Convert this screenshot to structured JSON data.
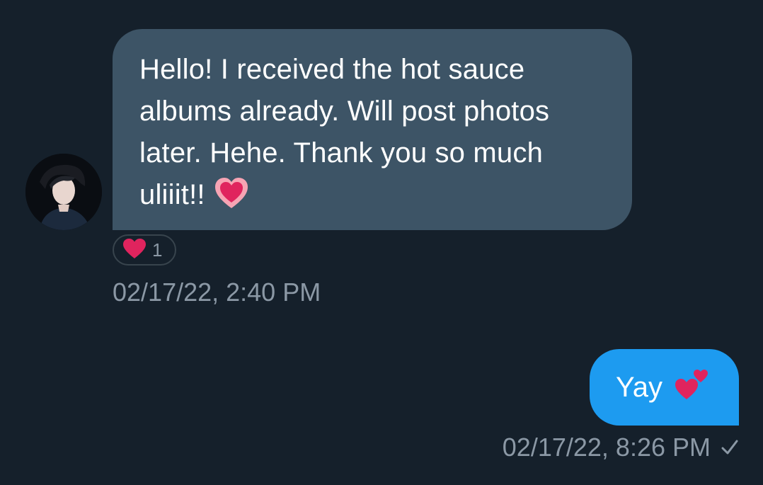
{
  "conversation": {
    "received_message": {
      "lines": [
        "Hello! I received the hot sauce",
        "albums already. Will post photos",
        "later. Hehe. Thank you so much",
        "uliiit!!"
      ],
      "emoji_icon": "heart-emoji-icon",
      "timestamp": "02/17/22, 2:40 PM",
      "reaction": {
        "icon": "red-heart-icon",
        "count": "1"
      }
    },
    "sent_message": {
      "text": "Yay",
      "emoji_icon": "two-hearts-emoji-icon",
      "timestamp": "02/17/22, 8:26 PM",
      "status_icon": "sent-checkmark-icon"
    }
  },
  "colors": {
    "background": "#15202b",
    "received_bubble": "#3d5466",
    "sent_bubble": "#1d9bf0",
    "muted_text": "#8b98a5",
    "heart_red": "#e0245e"
  }
}
